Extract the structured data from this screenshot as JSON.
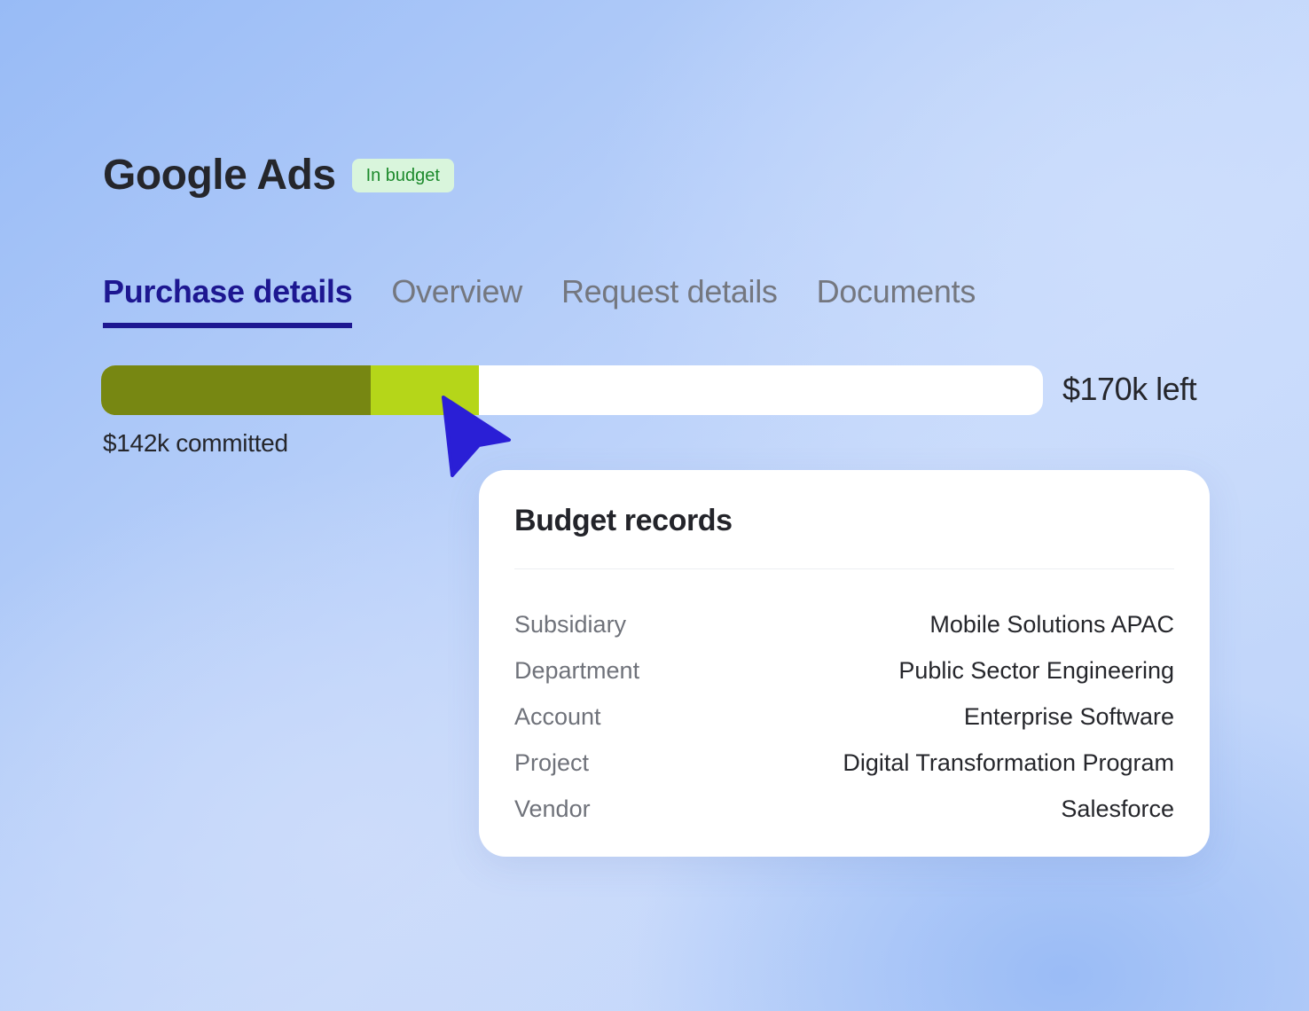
{
  "header": {
    "title": "Google Ads",
    "status_badge": "In budget"
  },
  "tabs": [
    {
      "label": "Purchase details",
      "active": true
    },
    {
      "label": "Overview",
      "active": false
    },
    {
      "label": "Request details",
      "active": false
    },
    {
      "label": "Documents",
      "active": false
    }
  ],
  "budget": {
    "committed_label": "$142k committed",
    "left_label": "$170k left",
    "committed_fraction": 0.286,
    "pending_fraction": 0.115
  },
  "colors": {
    "accent": "#1d1791",
    "committed": "#778712",
    "pending": "#b5d619",
    "badge_bg": "#d9f5dc",
    "badge_text": "#1d8a2c",
    "cursor": "#2a1fd6"
  },
  "budget_records": {
    "title": "Budget records",
    "rows": [
      {
        "label": "Subsidiary",
        "value": "Mobile Solutions APAC"
      },
      {
        "label": "Department",
        "value": "Public Sector Engineering"
      },
      {
        "label": "Account",
        "value": "Enterprise Software"
      },
      {
        "label": "Project",
        "value": "Digital Transformation Program"
      },
      {
        "label": "Vendor",
        "value": "Salesforce"
      }
    ]
  },
  "icons": {
    "cursor": "pointer-arrow-icon"
  }
}
